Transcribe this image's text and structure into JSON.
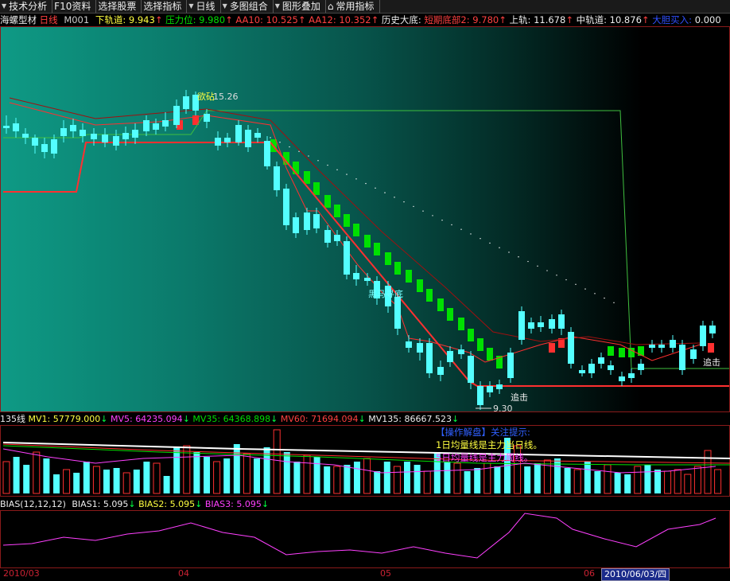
{
  "toolbar": {
    "items": [
      {
        "label": "技术分析",
        "arrow": true,
        "icon": false
      },
      {
        "label": "F10资料",
        "arrow": false,
        "icon": false
      },
      {
        "label": "选择股票",
        "arrow": false,
        "icon": false
      },
      {
        "label": "选择指标",
        "arrow": false,
        "icon": false
      },
      {
        "label": "日线",
        "arrow": true,
        "icon": false
      },
      {
        "label": "多图组合",
        "arrow": true,
        "icon": false
      },
      {
        "label": "图形叠加",
        "arrow": true,
        "icon": false
      },
      {
        "label": "常用指标",
        "arrow": false,
        "icon": true
      }
    ]
  },
  "info_bar": {
    "stock_name": "海螺型材",
    "period": "日线",
    "indicator": "M001",
    "lower_track_label": "下轨道:",
    "lower_track_value": "9.943",
    "pressure_label": "压力位:",
    "pressure_value": "9.980",
    "aa10_label": "AA10:",
    "aa10_value": "10.525",
    "aa12_label": "AA12:",
    "aa12_value": "10.352",
    "history_bottom_label": "历史大底:",
    "short_bottom_label": "短期底部2:",
    "short_bottom_value": "9.780",
    "upper_track_label": "上轨:",
    "upper_track_value": "11.678",
    "mid_track_label": "中轨道:",
    "mid_track_value": "10.876",
    "big_buy_label": "大胆买入:",
    "big_buy_value": "0.000",
    "arrow_up": "↑"
  },
  "main_chart": {
    "annotations": {
      "high_label": "15.26",
      "high_text": "欲砧",
      "black_horse": "黑马寻底",
      "chase1": "追击",
      "chase2": "追击",
      "low_label": "9.30"
    }
  },
  "volume_panel": {
    "name": "135线",
    "mv1_label": "MV1:",
    "mv1_value": "57779.000",
    "mv5_label": "MV5:",
    "mv5_value": "64235.094",
    "mv35_label": "MV35:",
    "mv35_value": "64368.898",
    "mv60_label": "MV60:",
    "mv60_value": "71694.094",
    "mv135_label": "MV135:",
    "mv135_value": "86667.523",
    "arrow_down": "↓",
    "note_title": "【操作解盘】",
    "note_title2": "关注提示:",
    "note_line1": "1日均量线是主力当日线。",
    "note_line2": "5日均量线是主力周线。"
  },
  "bias_panel": {
    "name": "BIAS(12,12,12)",
    "bias1_label": "BIAS1:",
    "bias1_value": "5.095",
    "bias2_label": "BIAS2:",
    "bias2_value": "5.095",
    "bias3_label": "BIAS3:",
    "bias3_value": "5.095",
    "arrow_down": "↓"
  },
  "date_bar": {
    "labels": [
      "2010/03",
      "04",
      "05",
      "06"
    ],
    "current_date": "2010/06/03/四"
  },
  "colors": {
    "up": "#ff3030",
    "down": "#54ffff",
    "green_band": "#00e000",
    "yellow": "#ffff40",
    "magenta": "#ff40ff",
    "red": "#ff3030"
  }
}
